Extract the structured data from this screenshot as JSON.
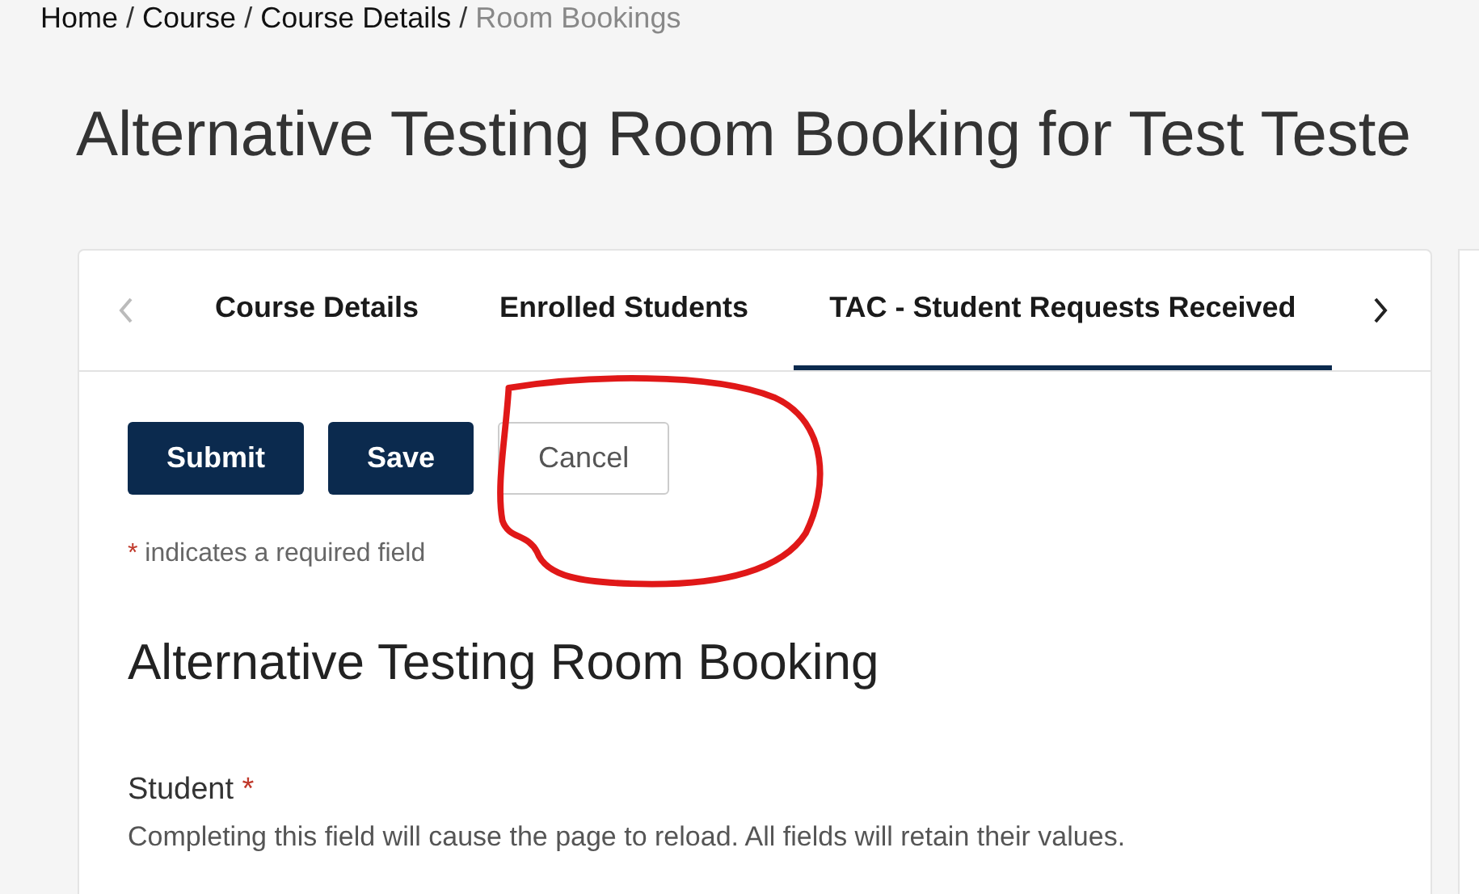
{
  "breadcrumb": [
    {
      "label": "Home",
      "current": false
    },
    {
      "label": "Course",
      "current": false
    },
    {
      "label": "Course Details",
      "current": false
    },
    {
      "label": "Room Bookings",
      "current": true
    }
  ],
  "breadcrumb_separator": "/",
  "page_title": "Alternative Testing Room Booking for Test Teste",
  "tabs": [
    {
      "label": "Course Details",
      "selected": false
    },
    {
      "label": "Enrolled Students",
      "selected": false
    },
    {
      "label": "TAC - Student Requests Received",
      "selected": true
    }
  ],
  "tab_scroll": {
    "prev_disabled": true,
    "next_disabled": false
  },
  "buttons": [
    {
      "label": "Submit",
      "kind": "primary"
    },
    {
      "label": "Save",
      "kind": "primary"
    },
    {
      "label": "Cancel",
      "kind": "secondary"
    }
  ],
  "required_note": {
    "mark": "*",
    "text": "indicates a required field"
  },
  "section_title": "Alternative Testing Room Booking",
  "field": {
    "label": "Student",
    "required_mark": "*",
    "help": "Completing this field will cause the page to reload. All fields will retain their values."
  }
}
